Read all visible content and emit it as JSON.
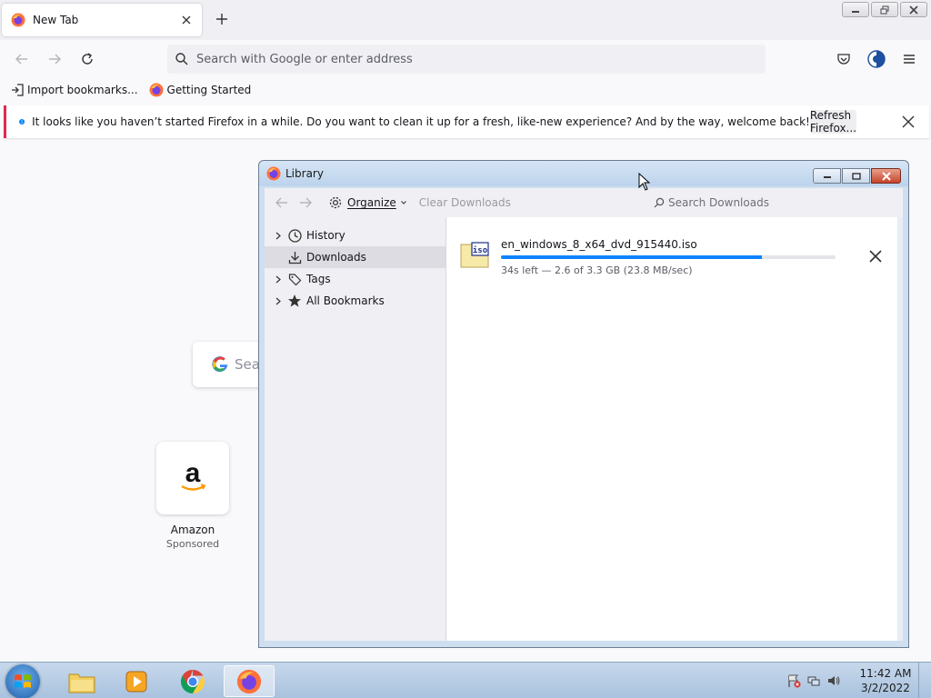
{
  "browser": {
    "tab_title": "New Tab",
    "address_placeholder": "Search with Google or enter address",
    "bookmarks": [
      {
        "label": "Import bookmarks..."
      },
      {
        "label": "Getting Started"
      }
    ],
    "infobar": {
      "message": "It looks like you haven’t started Firefox in a while. Do you want to clean it up for a fresh, like-new experience? And by the way, welcome back!",
      "button": "Refresh Firefox..."
    },
    "newtab": {
      "search_placeholder": "Sea",
      "tile_label": "Amazon",
      "tile_sublabel": "Sponsored"
    }
  },
  "library": {
    "title": "Library",
    "organize_label": "Organize",
    "clear_label": "Clear Downloads",
    "search_placeholder": "Search Downloads",
    "tree": [
      {
        "label": "History",
        "icon": "clock-icon",
        "expandable": true,
        "selected": false
      },
      {
        "label": "Downloads",
        "icon": "download-icon",
        "expandable": false,
        "selected": true
      },
      {
        "label": "Tags",
        "icon": "tag-icon",
        "expandable": true,
        "selected": false
      },
      {
        "label": "All Bookmarks",
        "icon": "star-icon",
        "expandable": true,
        "selected": false
      }
    ],
    "download": {
      "filename": "en_windows_8_x64_dvd_915440.iso",
      "status": "34s left — 2.6 of 3.3 GB (23.8 MB/sec)",
      "progress": 0.78
    }
  },
  "taskbar": {
    "time": "11:42 AM",
    "date": "3/2/2022"
  },
  "colors": {
    "accent": "#0a84ff",
    "infobar_border": "#e22850"
  }
}
